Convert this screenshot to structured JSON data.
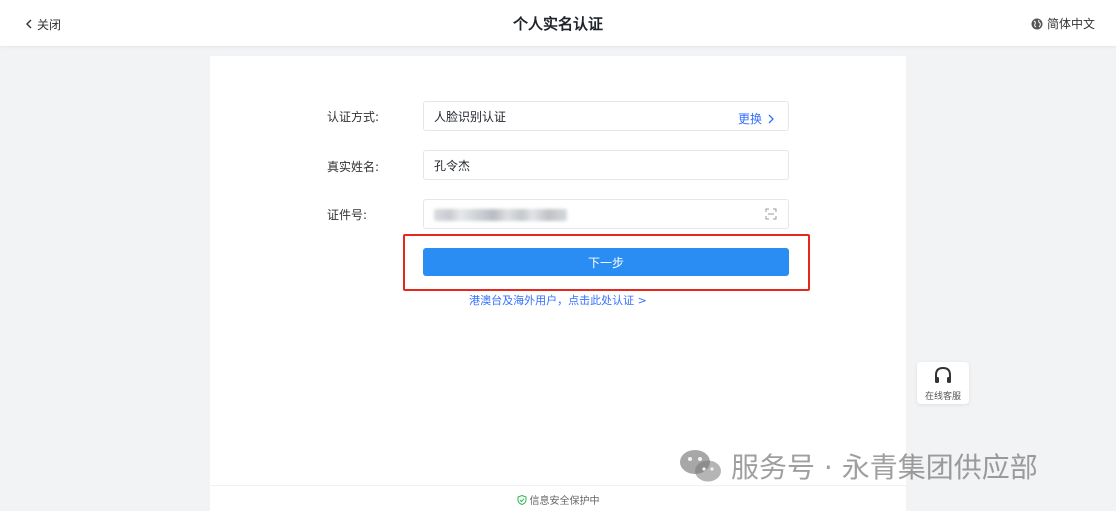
{
  "header": {
    "back_label": "关闭",
    "title": "个人实名认证",
    "language_label": "简体中文"
  },
  "form": {
    "method": {
      "label": "认证方式:",
      "value": "人脸识别认证",
      "change_label": "更换"
    },
    "name": {
      "label": "真实姓名:",
      "value": "孔令杰"
    },
    "id_number": {
      "label": "证件号:",
      "value_obscured": true
    }
  },
  "actions": {
    "next_label": "下一步",
    "overseas_label": "港澳台及海外用户，点击此处认证 >"
  },
  "footer": {
    "secure_label": "信息安全保护中"
  },
  "service": {
    "label": "在线客服"
  },
  "watermark": {
    "text": "服务号 · 永青集团供应部"
  },
  "colors": {
    "primary_button": "#2a8df4",
    "link": "#3370ff",
    "highlight_border": "#e8261c",
    "secure_icon": "#2db84d",
    "page_background": "#f2f3f5"
  },
  "icons": [
    "chevron-left-icon",
    "globe-icon",
    "chevron-right-icon",
    "scan-icon",
    "shield-check-icon",
    "headset-icon",
    "wechat-icon"
  ]
}
